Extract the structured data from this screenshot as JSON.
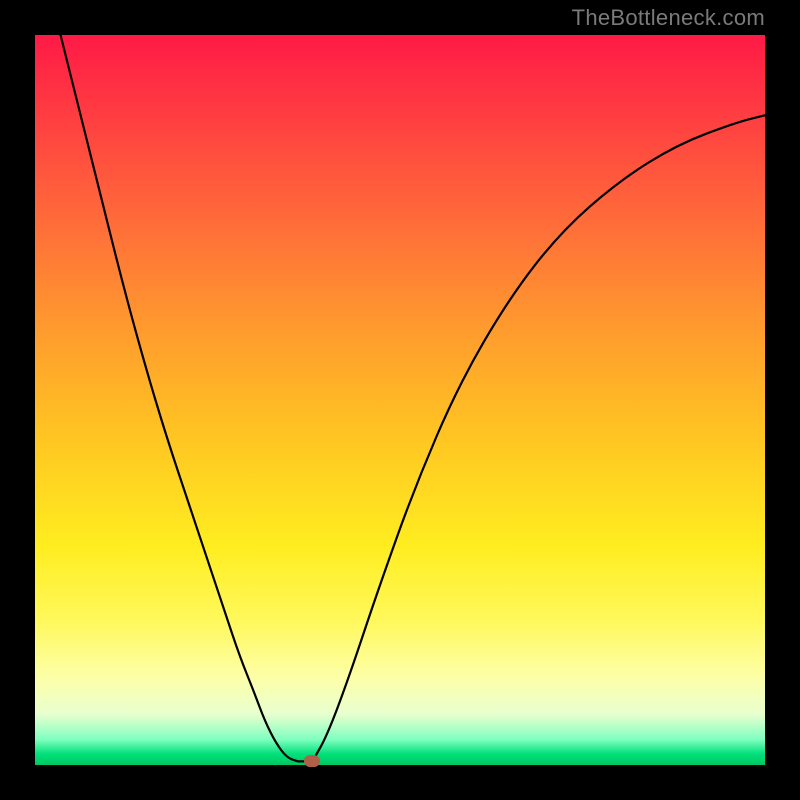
{
  "watermark": "TheBottleneck.com",
  "chart_data": {
    "type": "line",
    "title": "",
    "xlabel": "",
    "ylabel": "",
    "xlim": [
      0,
      100
    ],
    "ylim": [
      0,
      100
    ],
    "grid": false,
    "series": [
      {
        "name": "left-curve",
        "x": [
          3.5,
          6,
          9,
          12,
          15,
          18,
          21,
          24,
          26,
          28,
          30,
          31.5,
          33.0,
          34.5,
          36.0
        ],
        "values": [
          100,
          90,
          78,
          66,
          55,
          45,
          36,
          27,
          21,
          15,
          10,
          6.0,
          3.0,
          1.0,
          0.5
        ]
      },
      {
        "name": "floor",
        "x": [
          36.0,
          38.0
        ],
        "values": [
          0.5,
          0.5
        ]
      },
      {
        "name": "right-curve",
        "x": [
          38.0,
          40,
          43,
          47,
          52,
          58,
          65,
          72,
          80,
          88,
          96,
          100
        ],
        "values": [
          0.5,
          4,
          12,
          24,
          38,
          52,
          64,
          73,
          80,
          85,
          88,
          89
        ]
      }
    ],
    "marker": {
      "x": 38.0,
      "y": 0.5
    },
    "gradient_stops": [
      {
        "pos": 0,
        "color": "#ff1a46"
      },
      {
        "pos": 10,
        "color": "#ff3a42"
      },
      {
        "pos": 25,
        "color": "#ff6a3a"
      },
      {
        "pos": 40,
        "color": "#ff9a2e"
      },
      {
        "pos": 55,
        "color": "#ffc522"
      },
      {
        "pos": 70,
        "color": "#ffed20"
      },
      {
        "pos": 80,
        "color": "#fff85a"
      },
      {
        "pos": 88,
        "color": "#fdffa8"
      },
      {
        "pos": 93,
        "color": "#e9ffcf"
      },
      {
        "pos": 96.5,
        "color": "#7fffbf"
      },
      {
        "pos": 98.5,
        "color": "#00e07a"
      },
      {
        "pos": 100,
        "color": "#00c760"
      }
    ]
  }
}
